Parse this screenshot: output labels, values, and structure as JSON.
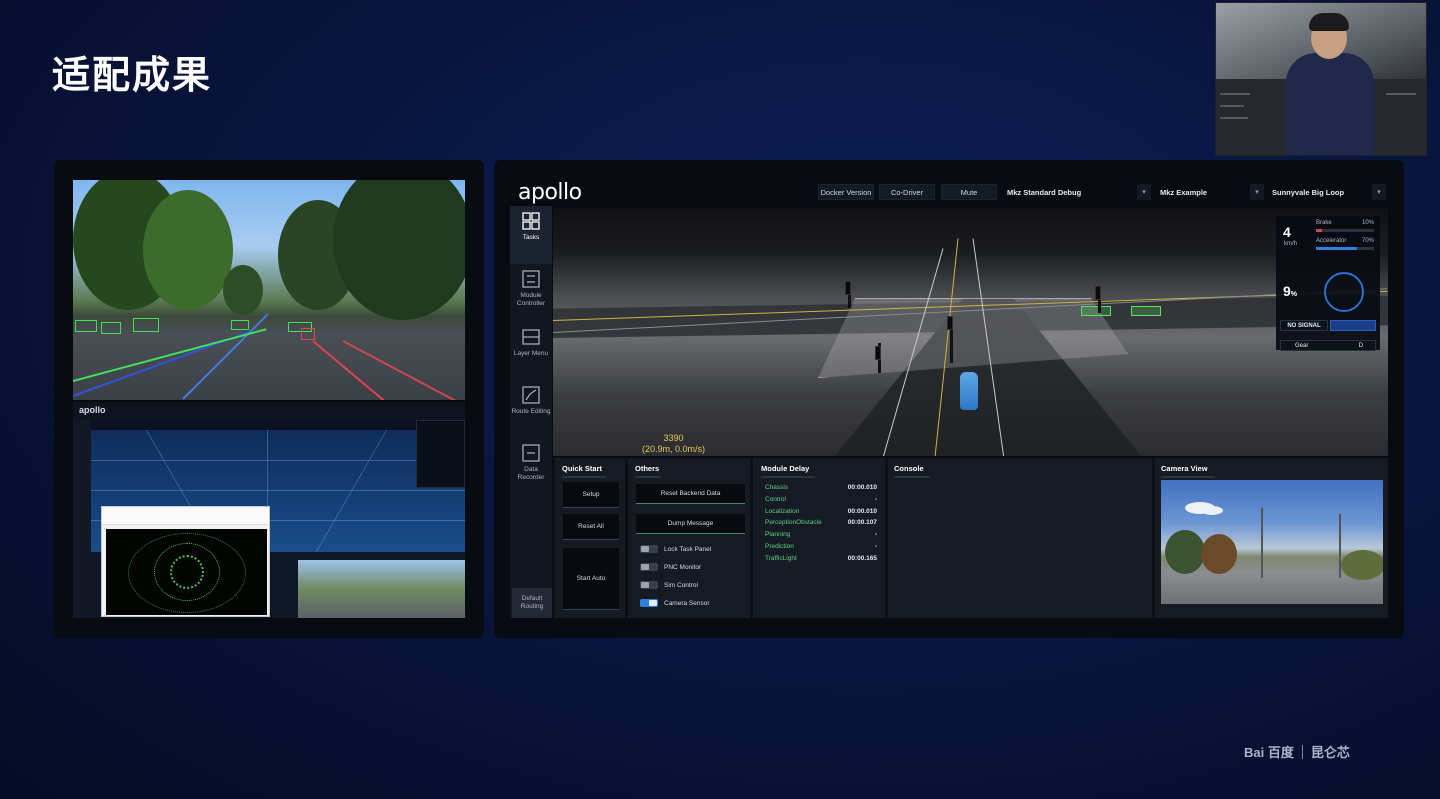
{
  "slide": {
    "title": "适配成果"
  },
  "apollo": {
    "logo": "apollo",
    "header": {
      "docker_version": "Docker Version",
      "co_driver": "Co-Driver",
      "mute": "Mute",
      "mode_select": "Mkz Standard Debug",
      "vehicle_select": "Mkz Example",
      "map_select": "Sunnyvale Big Loop"
    },
    "nav": [
      {
        "label": "Tasks",
        "icon": "grid-icon"
      },
      {
        "label": "Module Controller",
        "icon": "module-controller-icon"
      },
      {
        "label": "Layer Menu",
        "icon": "layer-menu-icon"
      },
      {
        "label": "Route Editing",
        "icon": "route-editing-icon"
      },
      {
        "label": "Data Recorder",
        "icon": "data-recorder-icon"
      }
    ],
    "default_routing": "Default Routing",
    "scene": {
      "ego_id": "3390",
      "ego_state": "(20.9m, 0.0m/s)"
    },
    "hud": {
      "speed": "4",
      "speed_unit": "km/h",
      "brake_label": "Brake",
      "brake_value": "10%",
      "brake_fraction": 0.1,
      "accel_label": "Accelerator",
      "accel_value": "70%",
      "accel_fraction": 0.7,
      "steering": "9",
      "steering_unit": "%",
      "signal": "NO SIGNAL",
      "gear_label": "Gear",
      "gear_value": "D"
    },
    "quick_start": {
      "title": "Quick Start",
      "setup": "Setup",
      "reset_all": "Reset All",
      "start_auto": "Start Auto"
    },
    "others": {
      "title": "Others",
      "reset_backend": "Reset Backend Data",
      "dump_message": "Dump Message",
      "toggles": [
        {
          "label": "Lock Task Panel",
          "on": false
        },
        {
          "label": "PNC Monitor",
          "on": false
        },
        {
          "label": "Sim Control",
          "on": false
        },
        {
          "label": "Camera Sensor",
          "on": true
        }
      ]
    },
    "module_delay": {
      "title": "Module Delay",
      "rows": [
        {
          "name": "Chassis",
          "value": "00:00.010"
        },
        {
          "name": "Control",
          "value": "-"
        },
        {
          "name": "Localization",
          "value": "00:00.010"
        },
        {
          "name": "PerceptionObstacle",
          "value": "00:00.107"
        },
        {
          "name": "Planning",
          "value": "-"
        },
        {
          "name": "Prediction",
          "value": "-"
        },
        {
          "name": "TrafficLight",
          "value": "00:00.165"
        }
      ]
    },
    "console": {
      "title": "Console"
    },
    "camera_view": {
      "title": "Camera View"
    }
  },
  "mini_apollo": {
    "logo": "apollo"
  },
  "footer": {
    "baidu": "Bai 百度",
    "kunlun": "昆仑芯"
  },
  "colors": {
    "accent_blue": "#2c7fe0",
    "module_green": "#5fd089",
    "detection_green": "#3fe05a",
    "background_navy": "#08163f"
  }
}
